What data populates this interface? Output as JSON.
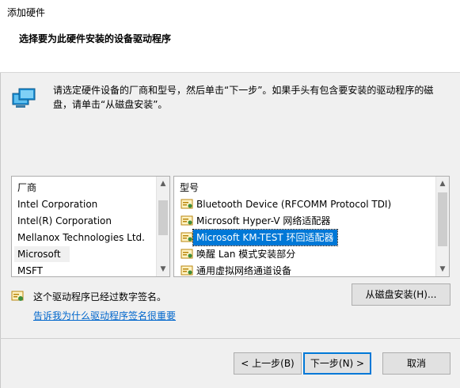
{
  "window": {
    "title": "添加硬件",
    "subtitle": "选择要为此硬件安装的设备驱动程序",
    "instruction": "请选定硬件设备的厂商和型号，然后单击“下一步”。如果手头有包含要安装的驱动程序的磁盘，请单击“从磁盘安装”。"
  },
  "manufacturers": {
    "header": "厂商",
    "items": [
      {
        "label": "Intel Corporation"
      },
      {
        "label": "Intel(R) Corporation"
      },
      {
        "label": "Mellanox Technologies Ltd."
      },
      {
        "label": "Microsoft"
      },
      {
        "label": "MSFT"
      }
    ],
    "selected": "Microsoft"
  },
  "models": {
    "header": "型号",
    "items": [
      {
        "label": "Bluetooth Device (RFCOMM Protocol TDI)"
      },
      {
        "label": "Microsoft Hyper-V 网络适配器"
      },
      {
        "label": "Microsoft KM-TEST 环回适配器"
      },
      {
        "label": "唤醒 Lan 模式安装部分"
      },
      {
        "label": "通用虚拟网络通道设备"
      }
    ],
    "selected": "Microsoft KM-TEST 环回适配器"
  },
  "signature": {
    "text": "这个驱动程序已经过数字签名。",
    "link": "告诉我为什么驱动程序签名很重要"
  },
  "buttons": {
    "have_disk": "从磁盘安装(H)...",
    "back": "< 上一步(B)",
    "next": "下一步(N) >",
    "cancel": "取消"
  },
  "colors": {
    "selection": "#0078d7",
    "link": "#0066cc",
    "dialog_bg": "#f0f0f0"
  },
  "icons": {
    "header_icon": "network-monitor-icon",
    "driver_icon": "driver-certificate-icon",
    "signed_icon": "certificate-icon"
  }
}
